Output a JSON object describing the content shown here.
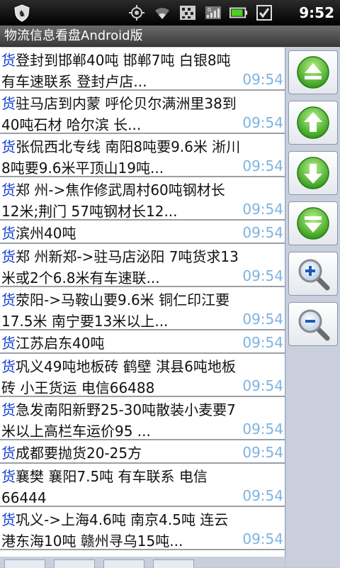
{
  "status_bar": {
    "time": "9:52",
    "icons": [
      "shield-icon",
      "gps-icon",
      "wifi-icon",
      "signal-grid-icon",
      "cell-signal-icon",
      "battery-icon",
      "checkbox-icon"
    ]
  },
  "app": {
    "title": "物流信息看盘Android版"
  },
  "list": {
    "items": [
      {
        "tag": "货",
        "text": "登封到邯郸40吨 邯郸7吨 白银8吨 有车速联系 登封卢店...",
        "time": "09:54"
      },
      {
        "tag": "货",
        "text": "驻马店到内蒙 呼伦贝尔满洲里38到40吨石材 哈尔滨 长...",
        "time": "09:54"
      },
      {
        "tag": "货",
        "text": "张侃西北专线 南阳8吨要9.6米 淅川8吨要9.6米平顶山19吨...",
        "time": "09:54"
      },
      {
        "tag": "货",
        "text": "郑 州->焦作修武周村60吨钢材长12米;荆门 57吨钢材长12...",
        "time": "09:54"
      },
      {
        "tag": "货",
        "text": "滨州40吨",
        "time": "09:54"
      },
      {
        "tag": "货",
        "text": "郑 州新郑->驻马店泌阳 7吨货求13米或2个6.8米有车速联...",
        "time": "09:54"
      },
      {
        "tag": "货",
        "text": "荥阳->马鞍山要9.6米 铜仁印江要17.5米 南宁要13米以上...",
        "time": "09:54"
      },
      {
        "tag": "货",
        "text": "江苏启东40吨",
        "time": "09:54"
      },
      {
        "tag": "货",
        "text": "巩义49吨地板砖 鹤壁 淇县6吨地板砖 小王货运 电信66488",
        "time": "09:54"
      },
      {
        "tag": "货",
        "text": "急发南阳新野25-30吨散装小麦要7米以上高栏车运价95 ...",
        "time": "09:54"
      },
      {
        "tag": "货",
        "text": "成都要抛货20-25方",
        "time": "09:54"
      },
      {
        "tag": "货",
        "text": "襄樊 襄阳7.5吨 有车联系 电信66444",
        "time": "09:54"
      },
      {
        "tag": "货",
        "text": "巩义->上海4.6吨 南京4.5吨 连云港东海10吨 赣州寻乌15吨...",
        "time": "09:54"
      }
    ]
  },
  "controls": [
    {
      "name": "scroll-top-button",
      "icon": "eject-up-icon"
    },
    {
      "name": "scroll-up-button",
      "icon": "arrow-up-icon"
    },
    {
      "name": "scroll-down-button",
      "icon": "arrow-down-icon"
    },
    {
      "name": "scroll-bottom-button",
      "icon": "eject-down-icon"
    },
    {
      "name": "zoom-in-button",
      "icon": "zoom-in-icon"
    },
    {
      "name": "zoom-out-button",
      "icon": "zoom-out-icon"
    }
  ]
}
